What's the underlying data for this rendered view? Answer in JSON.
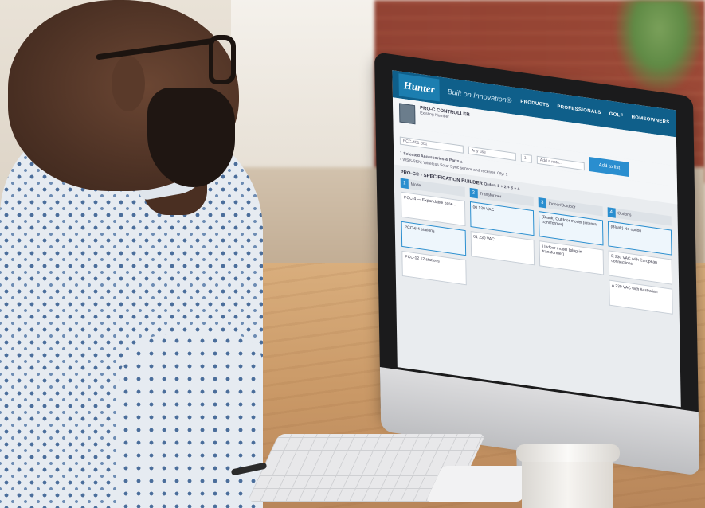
{
  "scene": {
    "description_hidden": "",
    "colors": {
      "nav": "#0f5f8a",
      "accent": "#2a8ecf",
      "desk": "#c99866",
      "shirt_dot": "#4b6e9b"
    }
  },
  "screen": {
    "brand": "Hunter",
    "tagline": "Built on Innovation®",
    "nav_links": [
      "PRODUCTS",
      "PROFESSIONALS",
      "GOLF",
      "HOMEOWNERS"
    ],
    "product_title": "PRO-C CONTROLLER",
    "product_sub": "Existing Number",
    "field_model": "PCC-401-801",
    "field_select": "Any use",
    "field_qty": "1",
    "field_note": "Add a note...",
    "accessories": "1 Selected Accessories & Parts ▴",
    "accessory_item": "• WSS-SEN: Wireless Solar Sync sensor and receiver. Qty: 1",
    "add_button": "Add to list",
    "builder_title": "PRO-C® - SPECIFICATION BUILDER",
    "builder_order": "Order: 1 + 2 + 3 + 4",
    "columns": [
      {
        "num": "1",
        "label": "Model",
        "cards": [
          "PCC-4 — Expandable base…",
          "PCC-6 4 stations",
          "PCC-12 12 stations"
        ]
      },
      {
        "num": "2",
        "label": "Transformer",
        "cards": [
          "00 120 VAC",
          "01 230 VAC"
        ]
      },
      {
        "num": "3",
        "label": "Indoor/Outdoor",
        "cards": [
          "(Blank) Outdoor model (internal transformer)",
          "i Indoor model (plug-in transformer)"
        ]
      },
      {
        "num": "4",
        "label": "Options",
        "cards": [
          "(Blank) No option",
          "E 230 VAC with European connections",
          "A 230 VAC with Australian"
        ]
      }
    ]
  }
}
